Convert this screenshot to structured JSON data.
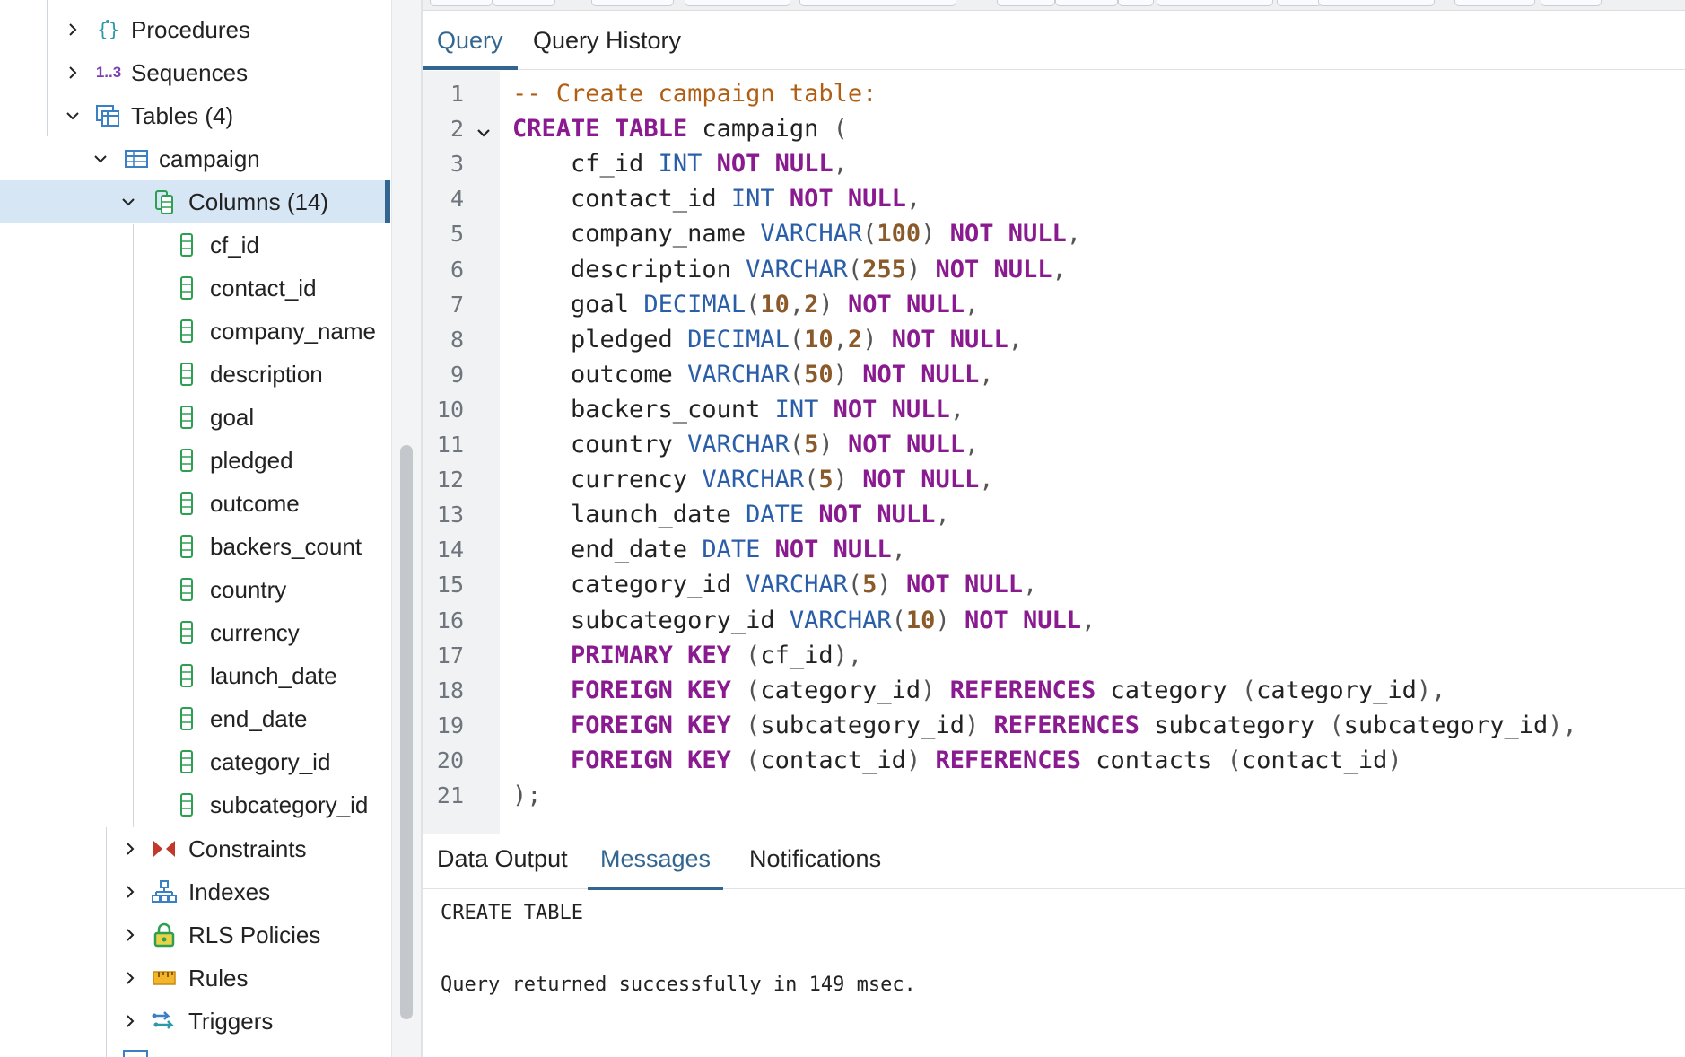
{
  "tree": {
    "procedures": "Procedures",
    "sequences": "Sequences",
    "sequences_icon_text": "1..3",
    "tables": "Tables (4)",
    "campaign": "campaign",
    "columns": "Columns (14)",
    "column_items": [
      "cf_id",
      "contact_id",
      "company_name",
      "description",
      "goal",
      "pledged",
      "outcome",
      "backers_count",
      "country",
      "currency",
      "launch_date",
      "end_date",
      "category_id",
      "subcategory_id"
    ],
    "constraints": "Constraints",
    "indexes": "Indexes",
    "rls_policies": "RLS Policies",
    "rules": "Rules",
    "triggers": "Triggers"
  },
  "query_tabs": {
    "query": "Query",
    "history": "Query History"
  },
  "editor": {
    "line_numbers": [
      "1",
      "2",
      "3",
      "4",
      "5",
      "6",
      "7",
      "8",
      "9",
      "10",
      "11",
      "12",
      "13",
      "14",
      "15",
      "16",
      "17",
      "18",
      "19",
      "20",
      "21"
    ],
    "lines": [
      [
        [
          "cm",
          "-- Create campaign table:"
        ]
      ],
      [
        [
          "kw",
          "CREATE"
        ],
        [
          "id",
          " "
        ],
        [
          "kw",
          "TABLE"
        ],
        [
          "id",
          " campaign "
        ],
        [
          "p",
          "("
        ]
      ],
      [
        [
          "id",
          "    cf_id "
        ],
        [
          "ty",
          "INT"
        ],
        [
          "id",
          " "
        ],
        [
          "kw",
          "NOT NULL"
        ],
        [
          "p",
          ","
        ]
      ],
      [
        [
          "id",
          "    contact_id "
        ],
        [
          "ty",
          "INT"
        ],
        [
          "id",
          " "
        ],
        [
          "kw",
          "NOT NULL"
        ],
        [
          "p",
          ","
        ]
      ],
      [
        [
          "id",
          "    company_name "
        ],
        [
          "ty",
          "VARCHAR"
        ],
        [
          "p",
          "("
        ],
        [
          "num",
          "100"
        ],
        [
          "p",
          ")"
        ],
        [
          "id",
          " "
        ],
        [
          "kw",
          "NOT NULL"
        ],
        [
          "p",
          ","
        ]
      ],
      [
        [
          "id",
          "    description "
        ],
        [
          "ty",
          "VARCHAR"
        ],
        [
          "p",
          "("
        ],
        [
          "num",
          "255"
        ],
        [
          "p",
          ")"
        ],
        [
          "id",
          " "
        ],
        [
          "kw",
          "NOT NULL"
        ],
        [
          "p",
          ","
        ]
      ],
      [
        [
          "id",
          "    goal "
        ],
        [
          "ty",
          "DECIMAL"
        ],
        [
          "p",
          "("
        ],
        [
          "num",
          "10"
        ],
        [
          "p",
          ","
        ],
        [
          "num",
          "2"
        ],
        [
          "p",
          ")"
        ],
        [
          "id",
          " "
        ],
        [
          "kw",
          "NOT NULL"
        ],
        [
          "p",
          ","
        ]
      ],
      [
        [
          "id",
          "    pledged "
        ],
        [
          "ty",
          "DECIMAL"
        ],
        [
          "p",
          "("
        ],
        [
          "num",
          "10"
        ],
        [
          "p",
          ","
        ],
        [
          "num",
          "2"
        ],
        [
          "p",
          ")"
        ],
        [
          "id",
          " "
        ],
        [
          "kw",
          "NOT NULL"
        ],
        [
          "p",
          ","
        ]
      ],
      [
        [
          "id",
          "    outcome "
        ],
        [
          "ty",
          "VARCHAR"
        ],
        [
          "p",
          "("
        ],
        [
          "num",
          "50"
        ],
        [
          "p",
          ")"
        ],
        [
          "id",
          " "
        ],
        [
          "kw",
          "NOT NULL"
        ],
        [
          "p",
          ","
        ]
      ],
      [
        [
          "id",
          "    backers_count "
        ],
        [
          "ty",
          "INT"
        ],
        [
          "id",
          " "
        ],
        [
          "kw",
          "NOT NULL"
        ],
        [
          "p",
          ","
        ]
      ],
      [
        [
          "id",
          "    country "
        ],
        [
          "ty",
          "VARCHAR"
        ],
        [
          "p",
          "("
        ],
        [
          "num",
          "5"
        ],
        [
          "p",
          ")"
        ],
        [
          "id",
          " "
        ],
        [
          "kw",
          "NOT NULL"
        ],
        [
          "p",
          ","
        ]
      ],
      [
        [
          "id",
          "    currency "
        ],
        [
          "ty",
          "VARCHAR"
        ],
        [
          "p",
          "("
        ],
        [
          "num",
          "5"
        ],
        [
          "p",
          ")"
        ],
        [
          "id",
          " "
        ],
        [
          "kw",
          "NOT NULL"
        ],
        [
          "p",
          ","
        ]
      ],
      [
        [
          "id",
          "    launch_date "
        ],
        [
          "ty",
          "DATE"
        ],
        [
          "id",
          " "
        ],
        [
          "kw",
          "NOT NULL"
        ],
        [
          "p",
          ","
        ]
      ],
      [
        [
          "id",
          "    end_date "
        ],
        [
          "ty",
          "DATE"
        ],
        [
          "id",
          " "
        ],
        [
          "kw",
          "NOT NULL"
        ],
        [
          "p",
          ","
        ]
      ],
      [
        [
          "id",
          "    category_id "
        ],
        [
          "ty",
          "VARCHAR"
        ],
        [
          "p",
          "("
        ],
        [
          "num",
          "5"
        ],
        [
          "p",
          ")"
        ],
        [
          "id",
          " "
        ],
        [
          "kw",
          "NOT NULL"
        ],
        [
          "p",
          ","
        ]
      ],
      [
        [
          "id",
          "    subcategory_id "
        ],
        [
          "ty",
          "VARCHAR"
        ],
        [
          "p",
          "("
        ],
        [
          "num",
          "10"
        ],
        [
          "p",
          ")"
        ],
        [
          "id",
          " "
        ],
        [
          "kw",
          "NOT NULL"
        ],
        [
          "p",
          ","
        ]
      ],
      [
        [
          "id",
          "    "
        ],
        [
          "kw",
          "PRIMARY KEY"
        ],
        [
          "id",
          " "
        ],
        [
          "p",
          "("
        ],
        [
          "id",
          "cf_id"
        ],
        [
          "p",
          "),"
        ]
      ],
      [
        [
          "id",
          "    "
        ],
        [
          "kw",
          "FOREIGN KEY"
        ],
        [
          "id",
          " "
        ],
        [
          "p",
          "("
        ],
        [
          "id",
          "category_id"
        ],
        [
          "p",
          ")"
        ],
        [
          "id",
          " "
        ],
        [
          "kw",
          "REFERENCES"
        ],
        [
          "id",
          " category "
        ],
        [
          "p",
          "("
        ],
        [
          "id",
          "category_id"
        ],
        [
          "p",
          "),"
        ]
      ],
      [
        [
          "id",
          "    "
        ],
        [
          "kw",
          "FOREIGN KEY"
        ],
        [
          "id",
          " "
        ],
        [
          "p",
          "("
        ],
        [
          "id",
          "subcategory_id"
        ],
        [
          "p",
          ")"
        ],
        [
          "id",
          " "
        ],
        [
          "kw",
          "REFERENCES"
        ],
        [
          "id",
          " subcategory "
        ],
        [
          "p",
          "("
        ],
        [
          "id",
          "subcategory_id"
        ],
        [
          "p",
          "),"
        ]
      ],
      [
        [
          "id",
          "    "
        ],
        [
          "kw",
          "FOREIGN KEY"
        ],
        [
          "id",
          " "
        ],
        [
          "p",
          "("
        ],
        [
          "id",
          "contact_id"
        ],
        [
          "p",
          ")"
        ],
        [
          "id",
          " "
        ],
        [
          "kw",
          "REFERENCES"
        ],
        [
          "id",
          " contacts "
        ],
        [
          "p",
          "("
        ],
        [
          "id",
          "contact_id"
        ],
        [
          "p",
          ")"
        ]
      ],
      [
        [
          "p",
          ");"
        ]
      ]
    ]
  },
  "result_tabs": {
    "data_output": "Data Output",
    "messages": "Messages",
    "notifications": "Notifications"
  },
  "messages": {
    "line1": "CREATE TABLE",
    "line2": "Query returned successfully in 149 msec."
  },
  "colors": {
    "accent": "#326690",
    "keyword": "#8a1a8f",
    "type": "#2a5ea8",
    "number": "#8b5a2b",
    "comment": "#b05e14"
  }
}
